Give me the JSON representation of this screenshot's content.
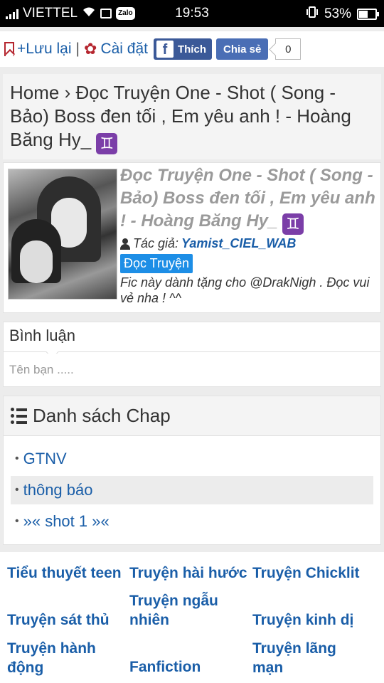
{
  "status_bar": {
    "carrier": "VIETTEL",
    "zalo": "Zalo",
    "time": "19:53",
    "battery": "53%",
    "battery_level": 0.53
  },
  "toolbar": {
    "save_label": "+Lưu lại",
    "separator": "|",
    "settings_label": "Cài đặt",
    "like_label": "Thích",
    "like_logo": "f",
    "share_label": "Chia sẻ",
    "share_count": "0"
  },
  "breadcrumb": {
    "text": "Home › Đọc Truyện One - Shot ( Song - Bảo) Boss đen tối , Em yêu anh ! - Hoàng Băng Hy_",
    "emoji": "♊"
  },
  "story": {
    "title": "Đọc Truyện One - Shot ( Song - Bảo) Boss đen tối , Em yêu anh ! - Hoàng Băng Hy_",
    "title_emoji": "♊",
    "author_label": "Tác giả:",
    "author": "Yamist_CIEL_WAB",
    "read_button": "Đọc Truyện",
    "description": "Fic này dành tặng cho @DrakNigh . Đọc vui vẻ nha ! ^^"
  },
  "comment": {
    "heading": "Bình luận",
    "placeholder": "Tên bạn ....."
  },
  "chapters": {
    "heading": "Danh sách Chap",
    "items": [
      {
        "label": "GTNV"
      },
      {
        "label": "thông báo"
      },
      {
        "label": "»« shot 1 »«"
      }
    ]
  },
  "categories": [
    "Tiểu thuyết teen",
    "Truyện hài hước",
    "Truyện Chicklit",
    "Truyện sát thủ",
    "Truyện ngẫu nhiên",
    "Truyện kinh dị",
    "Truyện hành động",
    "Fanfiction",
    "Truyện lãng mạn"
  ],
  "colors": {
    "link": "#1a5ea8",
    "facebook": "#3b5998",
    "share": "#4a6eb5",
    "read_button": "#1d8ee6",
    "accent_red": "#b5262f",
    "gemini_badge": "#7b3ea8"
  }
}
